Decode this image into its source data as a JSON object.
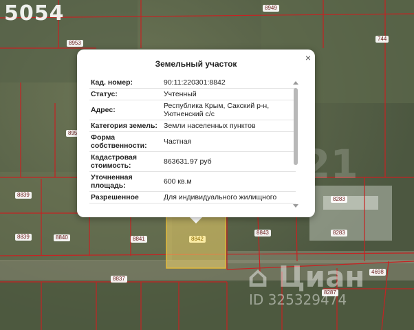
{
  "overlay_id": "5054",
  "map": {
    "parcel_labels": [
      {
        "id": "p8949",
        "text": "8949"
      },
      {
        "id": "p8953",
        "text": "8953"
      },
      {
        "id": "p744",
        "text": "744"
      },
      {
        "id": "p895x",
        "text": "895"
      },
      {
        "id": "p8839a",
        "text": "8839"
      },
      {
        "id": "p8839b",
        "text": "8839"
      },
      {
        "id": "p8840",
        "text": "8840"
      },
      {
        "id": "p8841",
        "text": "8841"
      },
      {
        "id": "p8842",
        "text": "8842"
      },
      {
        "id": "p8843",
        "text": "8843"
      },
      {
        "id": "p8283a",
        "text": "8283"
      },
      {
        "id": "p8283b",
        "text": "8283"
      },
      {
        "id": "p8837",
        "text": "8837"
      },
      {
        "id": "p4698",
        "text": "4698"
      },
      {
        "id": "p8287",
        "text": "8287"
      }
    ],
    "selected_parcel": "8842",
    "colors": {
      "boundary": "#c62222",
      "selected_fill": "#f3d66b",
      "selected_stroke": "#e2b93a"
    }
  },
  "watermark": {
    "logo": "⌂ Циан",
    "id": "ID 325329474",
    "num": "21",
    "c": "©"
  },
  "popup": {
    "title": "Земельный участок",
    "close": "×",
    "rows": [
      {
        "key": "Кад. номер:",
        "value": "90:11:220301:8842"
      },
      {
        "key": "Статус:",
        "value": "Учтенный"
      },
      {
        "key": "Адрес:",
        "value": "Республика Крым, Сакский р-н, Уютненский с/с"
      },
      {
        "key": "Категория земель:",
        "value": "Земли населенных пунктов"
      },
      {
        "key": "Форма собственности:",
        "value": "Частная"
      },
      {
        "key": "Кадастровая стоимость:",
        "value": "863631.97 руб"
      },
      {
        "key": "Уточненная площадь:",
        "value": "600 кв.м"
      },
      {
        "key": "Разрешенное",
        "value": "Для индивидуального жилищного"
      }
    ]
  }
}
